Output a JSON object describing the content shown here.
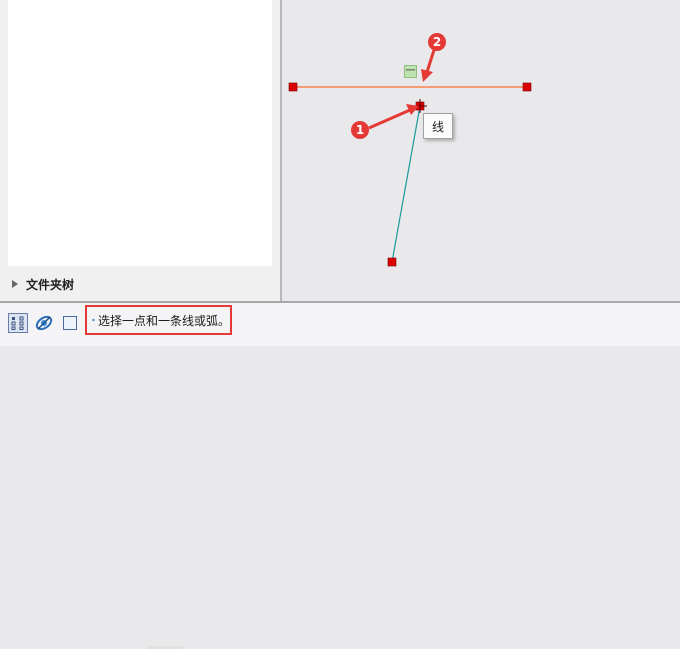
{
  "left_panel": {
    "file_tree_label": "文件夹树"
  },
  "canvas": {
    "tooltip_text": "线",
    "horizontal_constraint_symbol": "一",
    "line_color": "#ff6f2e",
    "construction_color": "#1a9a9a",
    "point_color": "#dd0000",
    "annotations": [
      {
        "label": "1"
      },
      {
        "label": "2"
      }
    ]
  },
  "status_bar": {
    "prompt": "选择一点和一条线或弧。",
    "icons": [
      "selection-filter-icon",
      "snap-icon",
      "box-select-icon",
      "arrow-right-icon"
    ]
  }
}
